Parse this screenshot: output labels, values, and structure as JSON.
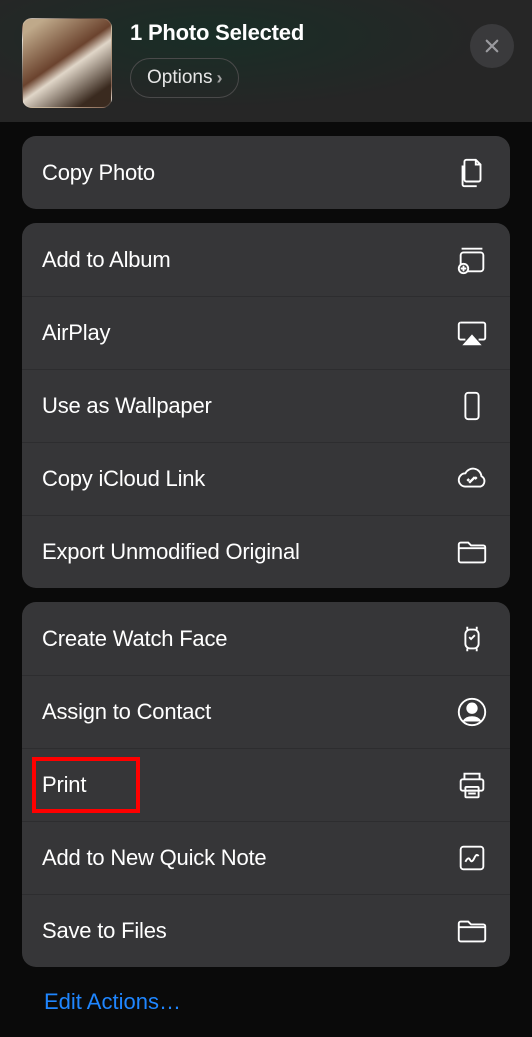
{
  "header": {
    "title": "1 Photo Selected",
    "options_label": "Options"
  },
  "group1": {
    "copy_photo": "Copy Photo"
  },
  "group2": {
    "add_to_album": "Add to Album",
    "airplay": "AirPlay",
    "use_as_wallpaper": "Use as Wallpaper",
    "copy_icloud_link": "Copy iCloud Link",
    "export_unmodified": "Export Unmodified Original"
  },
  "group3": {
    "create_watch_face": "Create Watch Face",
    "assign_to_contact": "Assign to Contact",
    "print": "Print",
    "add_to_quick_note": "Add to New Quick Note",
    "save_to_files": "Save to Files"
  },
  "footer": {
    "edit_actions": "Edit Actions…"
  }
}
